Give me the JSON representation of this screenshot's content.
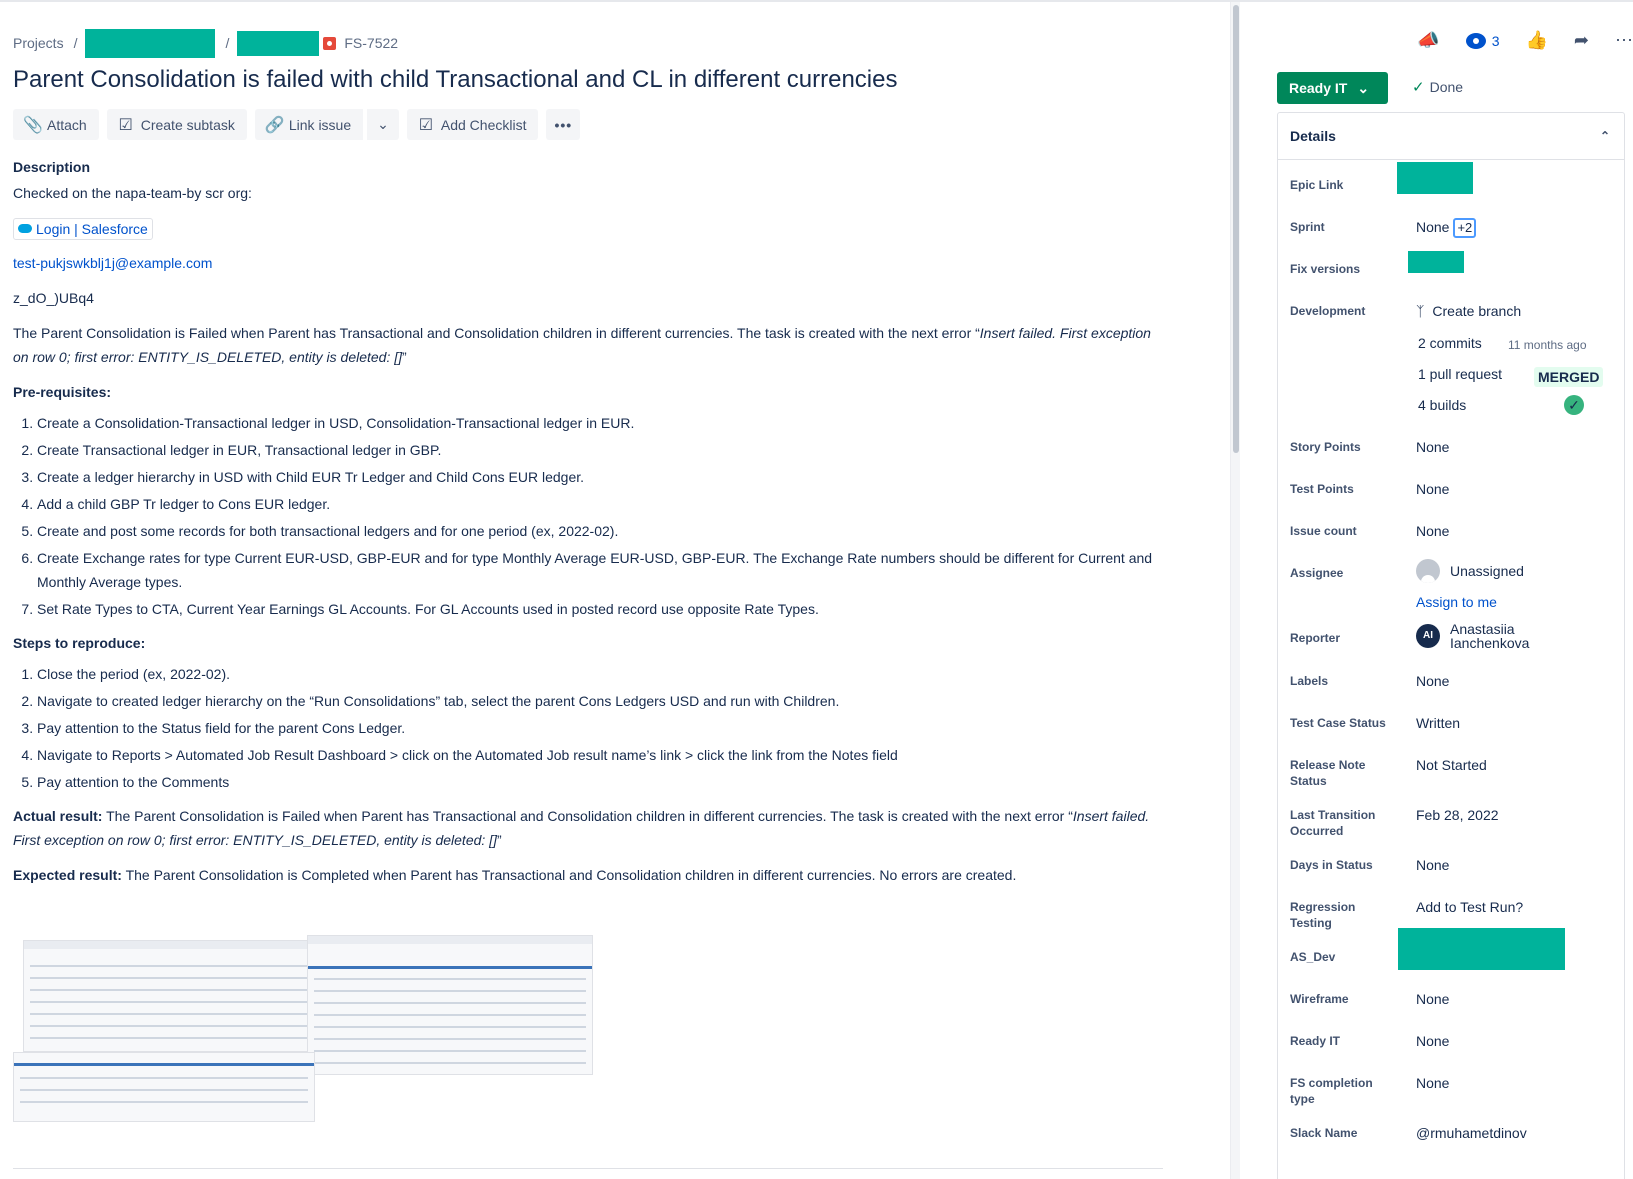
{
  "breadcrumbs": {
    "projects": "Projects",
    "sep": "/",
    "issue_key": "FS-7522"
  },
  "issue": {
    "title": "Parent Consolidation is failed with child Transactional and CL in different currencies"
  },
  "toolbar": {
    "attach": "Attach",
    "create_subtask": "Create subtask",
    "link_issue": "Link issue",
    "add_checklist": "Add Checklist",
    "more": "•••"
  },
  "description": {
    "heading": "Description",
    "intro": "Checked on the napa-team-by scr org:",
    "link_chip": "Login | Salesforce",
    "email": "test-pukjswkblj1j@example.com",
    "code": "z_dO_)UBq4",
    "para1_plain": "The Parent Consolidation is Failed when Parent has Transactional and Consolidation children in different currencies. The task is created with the next error “",
    "para1_italic": "Insert failed. First exception on row 0; first error: ENTITY_IS_DELETED, entity is deleted: []",
    "para1_end": "”",
    "prereq_heading": "Pre-requisites:",
    "prereqs": [
      "Create a Consolidation-Transactional ledger in USD, Consolidation-Transactional ledger in EUR.",
      "Create Transactional ledger in EUR, Transactional ledger in GBP.",
      "Create a ledger hierarchy in USD with Child EUR Tr Ledger and Child Cons EUR ledger.",
      "Add a child GBP Tr ledger to Cons EUR ledger.",
      "Create and post some records for both transactional ledgers and for one period (ex, 2022-02).",
      "Create Exchange rates for type Current EUR-USD, GBP-EUR and for type Monthly Average EUR-USD, GBP-EUR. The Exchange Rate numbers should be different for Current and Monthly Average types.",
      "Set Rate Types to CTA, Current Year Earnings GL Accounts. For GL Accounts used in posted record use opposite Rate Types."
    ],
    "steps_heading": "Steps to reproduce:",
    "steps": [
      "Close the period (ex, 2022-02).",
      "Navigate to created ledger hierarchy on the “Run Consolidations” tab, select the parent Cons Ledgers USD and run with Children.",
      "Pay attention to the Status field for the parent Cons Ledger.",
      "Navigate to Reports > Automated Job Result Dashboard > click on the Automated Job result name’s link > click the link from the Notes field",
      "Pay attention to the Comments"
    ],
    "actual_label": "Actual result:",
    "actual_plain": " The Parent Consolidation is Failed when Parent has Transactional and Consolidation children in different currencies. The task is created with the next error “",
    "actual_italic": "Insert failed. First exception on row 0; first error: ENTITY_IS_DELETED, entity is deleted: []",
    "actual_end": "”",
    "expected_label": "Expected result:",
    "expected_text": " The Parent Consolidation is Completed when Parent has Transactional and Consolidation children in different currencies. No errors are created."
  },
  "header_actions": {
    "watch_count": "3"
  },
  "status": {
    "current": "Ready IT",
    "transition": "Done"
  },
  "details": {
    "heading": "Details",
    "fields": {
      "epic_link": {
        "label": "Epic Link"
      },
      "sprint": {
        "label": "Sprint",
        "value": "None",
        "extra": "+2"
      },
      "fix_versions": {
        "label": "Fix versions"
      },
      "development": {
        "label": "Development",
        "create_branch": "Create branch",
        "commits": "2 commits",
        "commits_time": "11 months ago",
        "pull_request": "1 pull request",
        "pr_status": "MERGED",
        "builds": "4 builds"
      },
      "story_points": {
        "label": "Story Points",
        "value": "None"
      },
      "test_points": {
        "label": "Test Points",
        "value": "None"
      },
      "issue_count": {
        "label": "Issue count",
        "value": "None"
      },
      "assignee": {
        "label": "Assignee",
        "value": "Unassigned",
        "assign_me": "Assign to me"
      },
      "reporter": {
        "label": "Reporter",
        "initials": "AI",
        "first": "Anastasiia",
        "last": "Ianchenkova"
      },
      "labels": {
        "label": "Labels",
        "value": "None"
      },
      "test_case_status": {
        "label": "Test Case Status",
        "value": "Written"
      },
      "release_note_status": {
        "label": "Release Note Status",
        "value": "Not Started"
      },
      "last_transition": {
        "label": "Last Transition Occurred",
        "value": "Feb 28, 2022"
      },
      "days_in_status": {
        "label": "Days in Status",
        "value": "None"
      },
      "regression_testing": {
        "label": "Regression Testing",
        "value": "Add to Test Run?"
      },
      "as_dev": {
        "label": "AS_Dev"
      },
      "wireframe": {
        "label": "Wireframe",
        "value": "None"
      },
      "ready_it": {
        "label": "Ready IT",
        "value": "None"
      },
      "fs_completion": {
        "label": "FS completion type",
        "value": "None"
      },
      "slack_name": {
        "label": "Slack Name",
        "value": "@rmuhametdinov"
      }
    }
  },
  "colors": {
    "brand_green": "#00875a",
    "redaction": "#00b39b",
    "link": "#0052cc"
  }
}
